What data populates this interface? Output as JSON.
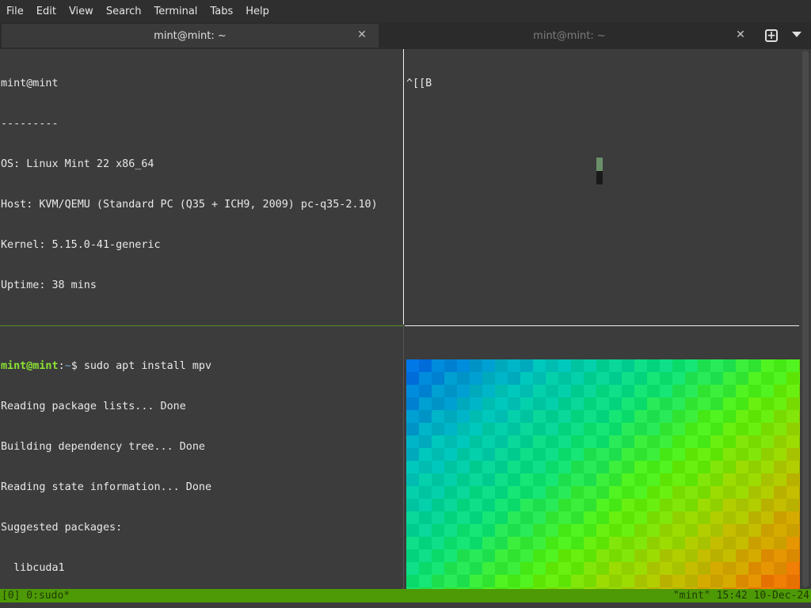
{
  "menubar": {
    "items": [
      "File",
      "Edit",
      "View",
      "Search",
      "Terminal",
      "Tabs",
      "Help"
    ]
  },
  "tabs": [
    {
      "label": "mint@mint: ~",
      "active": true
    },
    {
      "label": "mint@mint: ~",
      "active": false
    }
  ],
  "icons": {
    "tab_close": "close-icon",
    "new_tab": "plus-square-icon",
    "tabs_menu": "chevron-down-icon"
  },
  "panes": {
    "top_left": {
      "lines": [
        "mint@mint",
        "---------",
        "OS: Linux Mint 22 x86_64",
        "Host: KVM/QEMU (Standard PC (Q35 + ICH9, 2009) pc-q35-2.10)",
        "Kernel: 5.15.0-41-generic",
        "Uptime: 38 mins"
      ]
    },
    "top_right": {
      "lines": [
        "^[[B"
      ]
    },
    "bottom_left": {
      "prompt_user": "mint@mint",
      "prompt_sep": ":",
      "prompt_path": "~",
      "prompt_symbol": "$ ",
      "command": "sudo apt install mpv",
      "output": [
        "Reading package lists... Done",
        "Building dependency tree... Done",
        "Reading state information... Done",
        "Suggested packages:",
        "  libcuda1"
      ]
    }
  },
  "statusbar": {
    "left": "[0] 0:sudo*",
    "right": "\"mint\" 15:42 10-Dec-24"
  },
  "colors": {
    "terminal_bg": "#3c3c3c",
    "status_green": "#4e9a06",
    "prompt_green": "#8ae234",
    "prompt_blue": "#729fcf"
  }
}
